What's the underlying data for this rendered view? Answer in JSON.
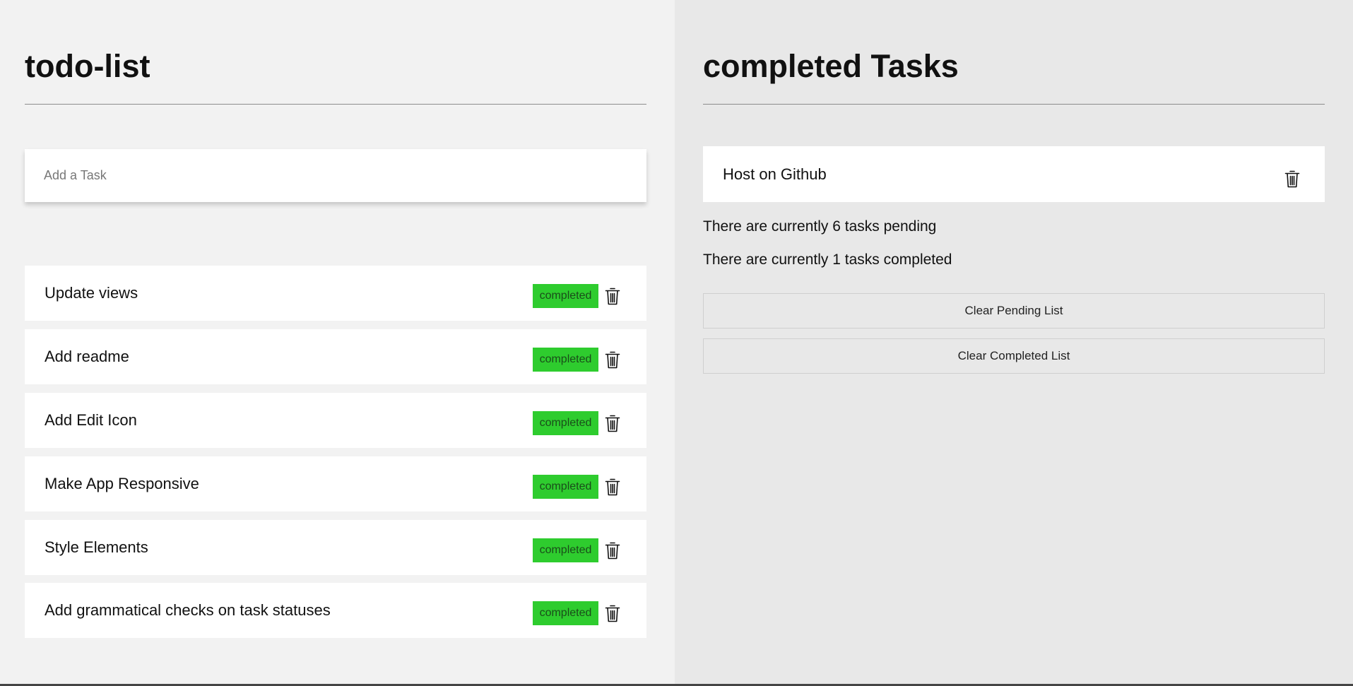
{
  "todo": {
    "title": "todo-list",
    "input_placeholder": "Add a Task",
    "status_label": "completed",
    "tasks": [
      {
        "text": "Update views"
      },
      {
        "text": "Add readme"
      },
      {
        "text": "Add Edit Icon"
      },
      {
        "text": "Make App Responsive"
      },
      {
        "text": "Style Elements"
      },
      {
        "text": "Add grammatical checks on task statuses"
      }
    ]
  },
  "completed": {
    "title": "completed Tasks",
    "tasks": [
      {
        "text": "Host on Github"
      }
    ],
    "pending_summary": "There are currently 6 tasks pending",
    "completed_summary": "There are currently 1 tasks completed",
    "clear_pending_label": "Clear Pending List",
    "clear_completed_label": "Clear Completed List"
  },
  "colors": {
    "status_badge": "#2ecc2e",
    "left_panel": "#f2f2f2",
    "right_panel": "#e8e8e8"
  },
  "icons": {
    "delete": "trash-icon"
  }
}
